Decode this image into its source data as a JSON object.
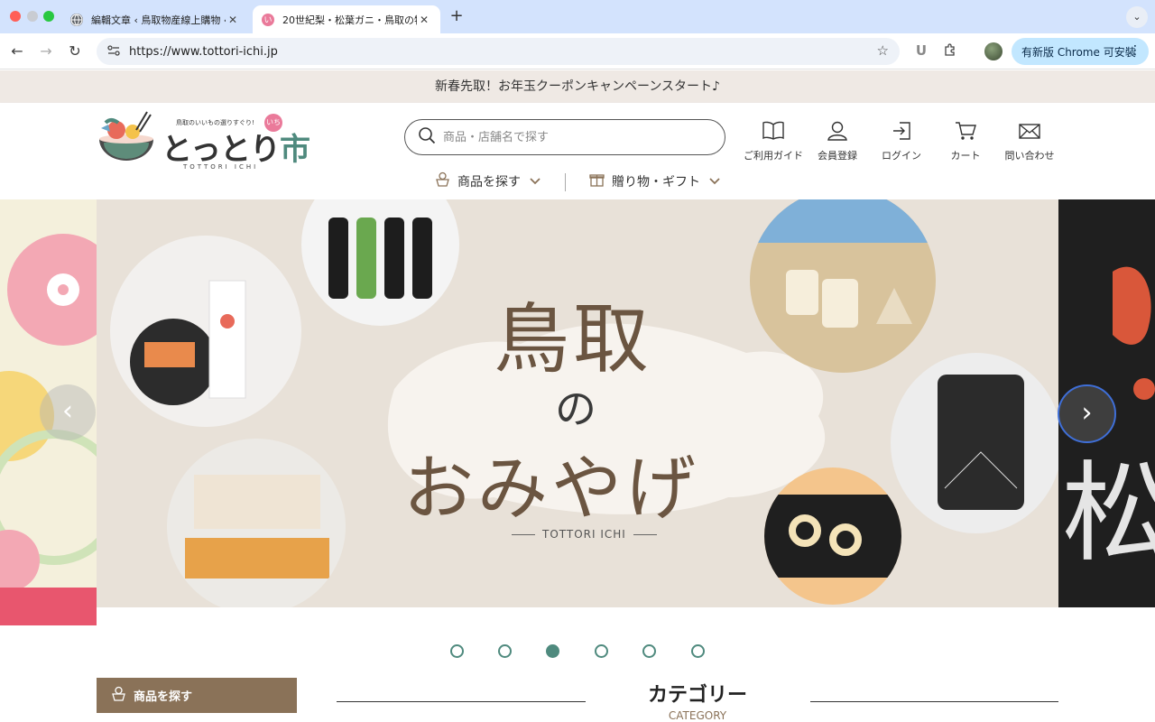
{
  "browser": {
    "tabs": [
      {
        "title": "編輯文章 ‹ 鳥取物産線上購物 ‹",
        "favicon": "globe-icon",
        "active": false
      },
      {
        "title": "20世紀梨・松葉ガニ・鳥取の特",
        "favicon": "tottori-ichi-favicon",
        "active": true
      }
    ],
    "new_tab": "+",
    "url": "https://www.tottori-ichi.jp",
    "update_button": "有新版 Chrome 可安裝",
    "extension_letter": "U"
  },
  "site": {
    "announcement": "新春先取！お年玉クーポンキャンペーンスタート♪",
    "logo": {
      "tagline": "鳥取のいいもの選りすぐり!",
      "name_kana": "とっとり",
      "name_kanji": "市",
      "romaji": "TOTTORI ICHI",
      "badge": "いち"
    },
    "search": {
      "placeholder": "商品・店舗名で探す",
      "value": ""
    },
    "header_nav": [
      {
        "label": "ご利用ガイド",
        "icon": "book-icon"
      },
      {
        "label": "会員登録",
        "icon": "user-icon"
      },
      {
        "label": "ログイン",
        "icon": "login-icon"
      },
      {
        "label": "カート",
        "icon": "cart-icon"
      },
      {
        "label": "問い合わせ",
        "icon": "mail-icon"
      }
    ],
    "menu": [
      {
        "label": "商品を探す",
        "icon": "basket-icon"
      },
      {
        "label": "贈り物・ギフト",
        "icon": "gift-icon"
      }
    ],
    "hero": {
      "title_line1": "鳥取",
      "title_line2": "の",
      "title_line3": "おみやげ",
      "subtitle": "TOTTORI ICHI",
      "right_slide_kanji": "松",
      "slide_count": 6,
      "active_slide": 3
    },
    "find_products_button": "商品を探す",
    "category": {
      "title": "カテゴリー",
      "subtitle": "CATEGORY"
    },
    "colors": {
      "accent_green": "#4f8a7e",
      "brown": "#8a7258",
      "announce_bg": "#efe9e4"
    }
  }
}
